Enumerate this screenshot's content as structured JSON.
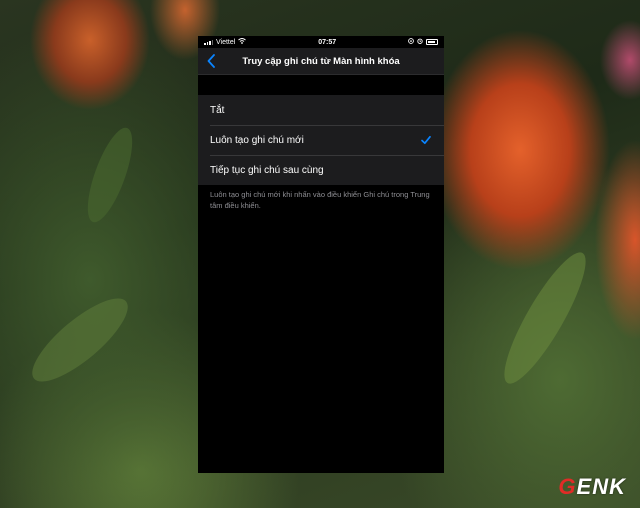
{
  "status_bar": {
    "carrier": "Viettel",
    "time": "07:57"
  },
  "nav": {
    "title": "Truy cập ghi chú từ Màn hình khóa"
  },
  "options": [
    {
      "label": "Tắt",
      "selected": false
    },
    {
      "label": "Luôn tạo ghi chú mới",
      "selected": true
    },
    {
      "label": "Tiếp tục ghi chú sau cùng",
      "selected": false
    }
  ],
  "footnote": "Luôn tạo ghi chú mới khi nhấn vào điều khiển Ghi chú trong Trung tâm điều khiển.",
  "watermark": {
    "first_letter": "G",
    "rest": "ENK"
  },
  "colors": {
    "accent": "#0a84ff",
    "logo_red": "#e22b26"
  },
  "icons": [
    "signal-bars-icon",
    "wifi-icon",
    "rotation-lock-icon",
    "alarm-icon",
    "battery-icon",
    "back-chevron-icon",
    "checkmark-icon"
  ]
}
